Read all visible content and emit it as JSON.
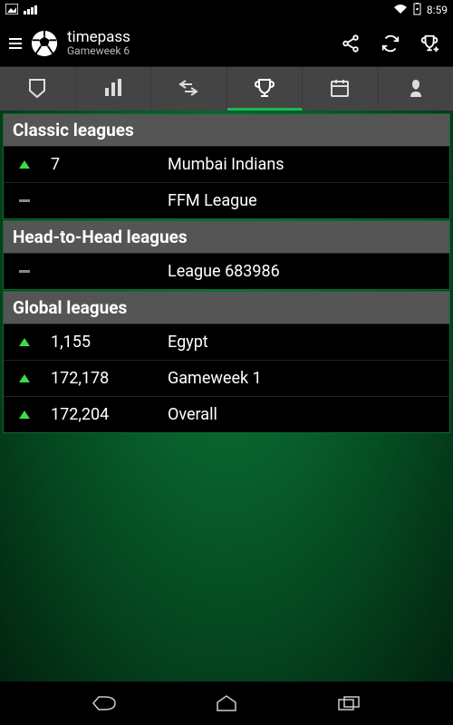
{
  "statusbar": {
    "time": "8:59"
  },
  "header": {
    "title": "timepass",
    "subtitle": "Gameweek 6"
  },
  "sections": {
    "classic": {
      "header": "Classic leagues",
      "rows": [
        {
          "movement": "up",
          "rank": "7",
          "name": "Mumbai Indians"
        },
        {
          "movement": "same",
          "rank": "",
          "name": "FFM League"
        }
      ]
    },
    "h2h": {
      "header": "Head-to-Head leagues",
      "rows": [
        {
          "movement": "same",
          "rank": "",
          "name": "League 683986"
        }
      ]
    },
    "global": {
      "header": "Global leagues",
      "rows": [
        {
          "movement": "up",
          "rank": "1,155",
          "name": "Egypt"
        },
        {
          "movement": "up",
          "rank": "172,178",
          "name": "Gameweek 1"
        },
        {
          "movement": "up",
          "rank": "172,204",
          "name": "Overall"
        }
      ]
    }
  }
}
